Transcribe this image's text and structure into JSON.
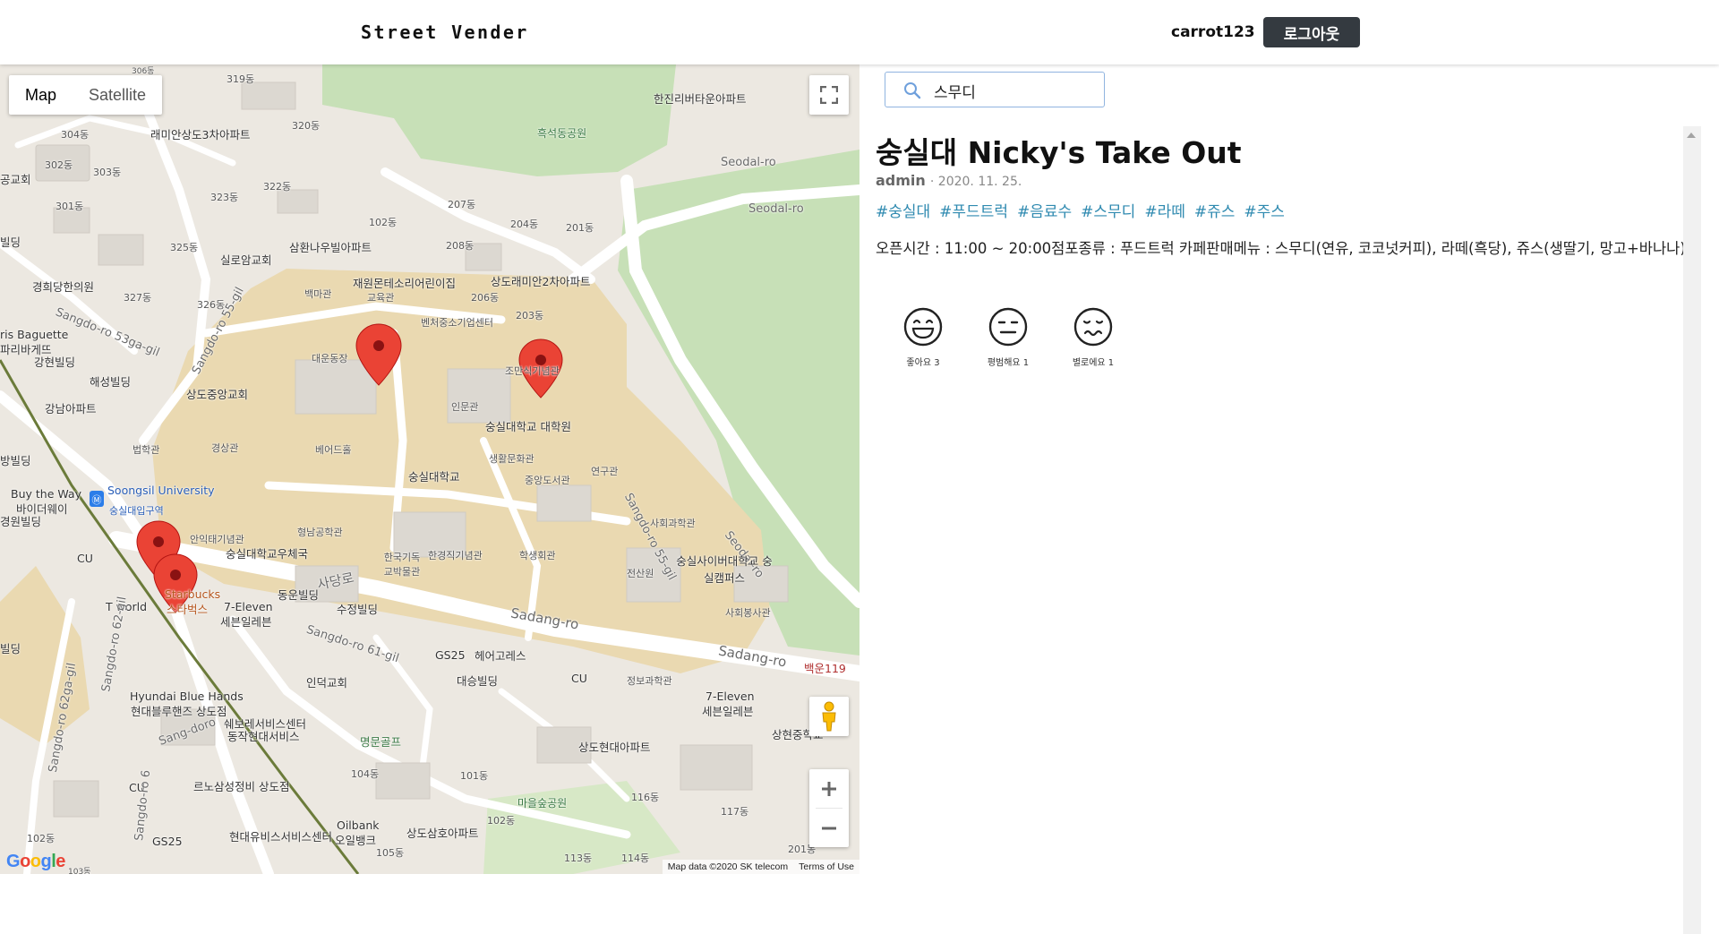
{
  "header": {
    "brand": "Street Vender",
    "username": "carrot123",
    "logout_label": "로그아웃"
  },
  "map": {
    "type_options": [
      "Map",
      "Satellite"
    ],
    "selected_type": "Map",
    "footer": {
      "data": "Map data ©2020 SK telecom",
      "terms": "Terms of Use"
    },
    "logo": "Google",
    "labels": {
      "l1": "319동",
      "l2": "래미안상도3차아파트",
      "l3": "320동",
      "l4": "304동",
      "l5": "302동",
      "l6": "303동",
      "l7": "301동",
      "l8": "323동",
      "l9": "322동",
      "l10": "325동",
      "l11": "327동",
      "l12": "326동",
      "l13": "실로암교회",
      "l14": "삼환나우빌아파트",
      "l15": "102동",
      "l16": "207동",
      "l17": "208동",
      "l18": "204동",
      "l19": "201동",
      "l20": "흑석동공원",
      "l21": "한진리버타운아파트",
      "l22": "Seodal-ro",
      "l23": "Seodal-ro",
      "l24": "경희당한의원",
      "l25": "Sangdo-ro 53ga-gil",
      "l26": "Sangdo-ro 55-gil",
      "l27": "재원몬테소리어린이집",
      "l28": "상도래미안2차아파트",
      "l29": "206동",
      "l30": "203동",
      "l31": "백마관",
      "l32": "교육관",
      "l33": "벤처중소기업센터",
      "l34": "ris Baguette",
      "l35": "파리바게뜨",
      "l36": "강현빌딩",
      "l37": "해성빌딩",
      "l38": "상도중앙교회",
      "l39": "대운동장",
      "l40": "조만식기념관",
      "l41": "인문관",
      "l42": "숭실대학교 대학원",
      "l43": "강남아파트",
      "l44": "법학관",
      "l45": "경상관",
      "l46": "베어드홀",
      "l47": "숭실대학교",
      "l48": "생활문화관",
      "l49": "중앙도서관",
      "l50": "연구관",
      "l51": "Sangdo-ro 55-gil",
      "l52": "Seodal-ro",
      "l53": "Buy the Way",
      "l54": "바이더웨이",
      "l55": "Soongsil University",
      "l56": "숭실대입구역",
      "l57": "경원빌딩",
      "l58": "안익태기념관",
      "l59": "형남공학관",
      "l60": "숭실대학교우체국",
      "l61": "사회과학관",
      "l62": "숭실사이버대학교 숭실캠퍼스",
      "l63": "한국기독교박물관",
      "l64": "한경직기념관",
      "l65": "학생회관",
      "l66": "전산원",
      "l67": "CU",
      "l68": "Starbucks",
      "l69": "스타벅스",
      "l70": "T world",
      "l71": "7-Eleven",
      "l72": "세븐일레븐",
      "l73": "동운빌딩",
      "l74": "수정빌딩",
      "l75": "사당로",
      "l76": "Sadang-ro",
      "l77": "Sadang-ro",
      "l78": "사회봉사관",
      "l79": "백운119",
      "l80": "Sangdo-ro 61-gil",
      "l81": "GS25",
      "l82": "헤어고레스",
      "l83": "대승빌딩",
      "l84": "CU",
      "l85": "정보과학관",
      "l86": "7-Eleven",
      "l87": "세븐일레븐",
      "l88": "상현중학교",
      "l89": "인덕교회",
      "l90": "Hyundai Blue Hands",
      "l91": "현대블루핸즈 상도점",
      "l92": "쉐보레서비스센터",
      "l93": "동작현대서비스",
      "l94": "Sang-doro",
      "l95": "명문골프",
      "l96": "상도현대아파트",
      "l97": "Sangdo-ro 62-gil",
      "l98": "Sangdo-ro 62ga-gil",
      "l99": "CU",
      "l100": "르노삼성정비 상도점",
      "l101": "104동",
      "l102": "101동",
      "l103": "마을숲공원",
      "l104": "116동",
      "l105": "117동",
      "l106": "102동",
      "l107": "GS25",
      "l108": "Oilbank",
      "l109": "오일뱅크",
      "l110": "현대유비스서비스센터",
      "l111": "상도삼호아파트",
      "l112": "105동",
      "l113": "113동",
      "l114": "114동",
      "l115": "201동",
      "l116": "Sangdo-ro 6",
      "l117": "102동",
      "l118": "103동",
      "l119": "공교회",
      "l120": "빌딩",
      "l121": "방빌딩",
      "l122": "빌딩",
      "l123": "306동"
    }
  },
  "search": {
    "value": "스무디",
    "placeholder": ""
  },
  "post": {
    "title": "숭실대 Nicky's Take Out",
    "author": "admin",
    "date": "· 2020. 11. 25.",
    "tags": [
      "#숭실대",
      "#푸드트럭",
      "#음료수",
      "#스무디",
      "#라떼",
      "#쥬스",
      "#주스"
    ],
    "content": "오픈시간 : 11:00 ~ 20:00점포종류 : 푸드트럭 카페판매메뉴 : 스무디(연유, 코코넛커피), 라떼(흑당), 쥬스(생딸기, 망고+바나나)",
    "reactions": [
      {
        "label": "좋아요 3",
        "icon": "laughing-face-icon"
      },
      {
        "label": "평범해요 1",
        "icon": "neutral-face-icon"
      },
      {
        "label": "별로에요 1",
        "icon": "uneasy-face-icon"
      }
    ]
  },
  "colors": {
    "accent_dark": "#343a40",
    "tag": "#2f8ab0",
    "marker": "#ea4335",
    "park": "#c7e0b7",
    "campus": "#e8d7b0"
  }
}
